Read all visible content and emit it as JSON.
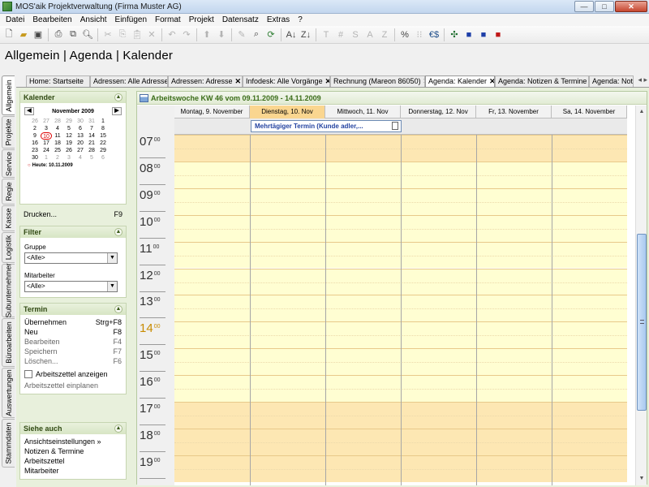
{
  "window": {
    "title": "MOS'aik Projektverwaltung (Firma Muster AG)",
    "minimize": "—",
    "maximize": "□",
    "close": "✕"
  },
  "menu": [
    "Datei",
    "Bearbeiten",
    "Ansicht",
    "Einfügen",
    "Format",
    "Projekt",
    "Datensatz",
    "Extras",
    "?"
  ],
  "toolbar": {
    "bold_T": "T",
    "hash": "#",
    "S": "S",
    "A": "A",
    "Z": "Z",
    "percent": "%",
    "euro": "€$"
  },
  "breadcrumb": "Allgemein | Agenda | Kalender",
  "vertical_tabs": [
    "Allgemein",
    "Projekte",
    "Service",
    "Regie",
    "Kasse",
    "Logistik",
    "Subunternehmer",
    "Büroarbeiten",
    "Auswertungen",
    "Stammdaten"
  ],
  "doc_tabs": [
    {
      "label": "Home: Startseite",
      "close": ""
    },
    {
      "label": "Adressen: Alle Adressen",
      "close": "✕"
    },
    {
      "label": "Adressen: Adresse",
      "close": "✕"
    },
    {
      "label": "Infodesk: Alle Vorgänge",
      "close": "✕"
    },
    {
      "label": "Rechnung (Mareon 86050)",
      "close": "✕"
    },
    {
      "label": "Agenda: Kalender",
      "close": "✕"
    },
    {
      "label": "Agenda: Notizen & Termine",
      "close": "✕"
    },
    {
      "label": "Agenda: Notiz",
      "close": ""
    }
  ],
  "tab_arrows": "◂ ▸",
  "sidebar": {
    "kalender": {
      "title": "Kalender",
      "month": "November 2009",
      "weekdays": [
        "",
        "",
        "",
        "",
        "",
        "",
        ""
      ],
      "days": [
        [
          "26",
          "27",
          "28",
          "29",
          "30",
          "31",
          "1"
        ],
        [
          "2",
          "3",
          "4",
          "5",
          "6",
          "7",
          "8"
        ],
        [
          "9",
          "10",
          "11",
          "12",
          "13",
          "14",
          "15"
        ],
        [
          "16",
          "17",
          "18",
          "19",
          "20",
          "21",
          "22"
        ],
        [
          "23",
          "24",
          "25",
          "26",
          "27",
          "28",
          "29"
        ],
        [
          "30",
          "1",
          "2",
          "3",
          "4",
          "5",
          "6"
        ]
      ],
      "today_label": "Heute: 10.11.2009",
      "print_label": "Drucken...",
      "print_key": "F9"
    },
    "filter": {
      "title": "Filter",
      "group_label": "Gruppe",
      "group_value": "<Alle>",
      "employee_label": "Mitarbeiter",
      "employee_value": "<Alle>"
    },
    "termin": {
      "title": "Termin",
      "items": [
        {
          "label": "Übernehmen",
          "key": "Strg+F8"
        },
        {
          "label": "Neu",
          "key": "F8"
        },
        {
          "label": "Bearbeiten",
          "key": "F4"
        },
        {
          "label": "Speichern",
          "key": "F7"
        },
        {
          "label": "Löschen...",
          "key": "F6"
        }
      ],
      "checkbox_label": "Arbeitszettel anzeigen",
      "plan_label": "Arbeitszettel einplanen"
    },
    "siehe_auch": {
      "title": "Siehe auch",
      "items": [
        "Ansichtseinstellungen »",
        "Notizen & Termine",
        "Arbeitszettel",
        "Mitarbeiter"
      ]
    }
  },
  "calendar": {
    "header": "Arbeitswoche KW 46 vom 09.11.2009 - 14.11.2009",
    "days": [
      "Montag, 9. November",
      "Dienstag, 10. Nov",
      "Mittwoch, 11. Nov",
      "Donnerstag, 12. Nov",
      "Fr, 13. November",
      "Sa, 14. November"
    ],
    "today_index": 1,
    "event": "Mehrtägiger Termin (Kunde adler,...",
    "hours": [
      "07",
      "08",
      "09",
      "10",
      "11",
      "12",
      "13",
      "14",
      "15",
      "16",
      "17",
      "18",
      "19"
    ],
    "minutes": "00",
    "current_hour": "14",
    "colors": {
      "work": "#fffed2",
      "offwork": "#fde7b3",
      "today_header": "#fad690",
      "accent": "#3b6d1a"
    }
  }
}
